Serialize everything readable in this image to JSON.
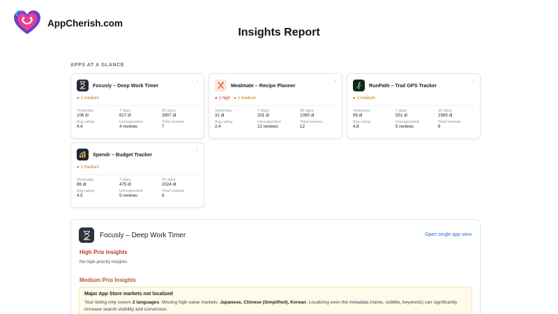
{
  "brand": {
    "name": "AppCherish.com"
  },
  "page": {
    "title": "Insights Report",
    "section_label": "APPS AT A GLANCE"
  },
  "apps": [
    {
      "name": "Focusly – Deep Work Timer",
      "icon": "hourglass-icon",
      "badges": [
        {
          "level": "medium",
          "text": "1 medium"
        }
      ],
      "stats": {
        "yesterday_label": "Yesterday",
        "yesterday": "106 dl",
        "d7_label": "7 days",
        "d7": "817 dl",
        "d30_label": "30 days",
        "d30": "3907 dl",
        "rating_label": "Avg rating",
        "rating": "4.4",
        "unresp_label": "Unresponded",
        "unresp": "4 reviews",
        "total_label": "Total reviews",
        "total": "7"
      }
    },
    {
      "name": "Mealmate – Recipe Planner",
      "icon": "utensils-icon",
      "badges": [
        {
          "level": "high",
          "text": "1 high"
        },
        {
          "level": "medium",
          "text": "2 medium"
        }
      ],
      "stats": {
        "yesterday_label": "Yesterday",
        "yesterday": "31 dl",
        "d7_label": "7 days",
        "d7": "201 dl",
        "d30_label": "30 days",
        "d30": "1095 dl",
        "rating_label": "Avg rating",
        "rating": "2.4",
        "unresp_label": "Unresponded",
        "unresp": "12 reviews",
        "total_label": "Total reviews",
        "total": "12"
      }
    },
    {
      "name": "RunPath – Trail GPS Tracker",
      "icon": "trail-runner-icon",
      "badges": [
        {
          "level": "medium",
          "text": "1 medium"
        }
      ],
      "stats": {
        "yesterday_label": "Yesterday",
        "yesterday": "99 dl",
        "d7_label": "7 days",
        "d7": "551 dl",
        "d30_label": "30 days",
        "d30": "2589 dl",
        "rating_label": "Avg rating",
        "rating": "4.8",
        "unresp_label": "Unresponded",
        "unresp": "5 reviews",
        "total_label": "Total reviews",
        "total": "8"
      }
    },
    {
      "name": "Spendr – Budget Tracker",
      "icon": "coins-chart-icon",
      "badges": [
        {
          "level": "medium",
          "text": "1 medium"
        }
      ],
      "stats": {
        "yesterday_label": "Yesterday",
        "yesterday": "86 dl",
        "d7_label": "7 days",
        "d7": "475 dl",
        "d30_label": "30 days",
        "d30": "2024 dl",
        "rating_label": "Avg rating",
        "rating": "4.5",
        "unresp_label": "Unresponded",
        "unresp": "5 reviews",
        "total_label": "Total reviews",
        "total": "8"
      }
    }
  ],
  "detail": {
    "app_name": "Focusly – Deep Work Timer",
    "open_link": "Open single app view",
    "high_heading": "High Prio Insights",
    "high_empty": "No high-priority insights.",
    "medium_heading": "Medium Prio Insights",
    "insight": {
      "title": "Major App Store markets not localized",
      "body_1": "Your listing only covers ",
      "body_bold_1": "2 languages",
      "body_2": ". Missing high-value markets: ",
      "body_bold_2": "Japanese, Chinese (Simplified), Korean",
      "body_3": ". Localizing even the metadata (name, subtitle, keywords) can significantly increase search visibility and conversion."
    }
  },
  "colors": {
    "medium": "#c47a07",
    "high": "#c9302c",
    "link": "#2f6fd0",
    "high_heading": "#b83a2e",
    "medium_heading": "#b8582e"
  }
}
